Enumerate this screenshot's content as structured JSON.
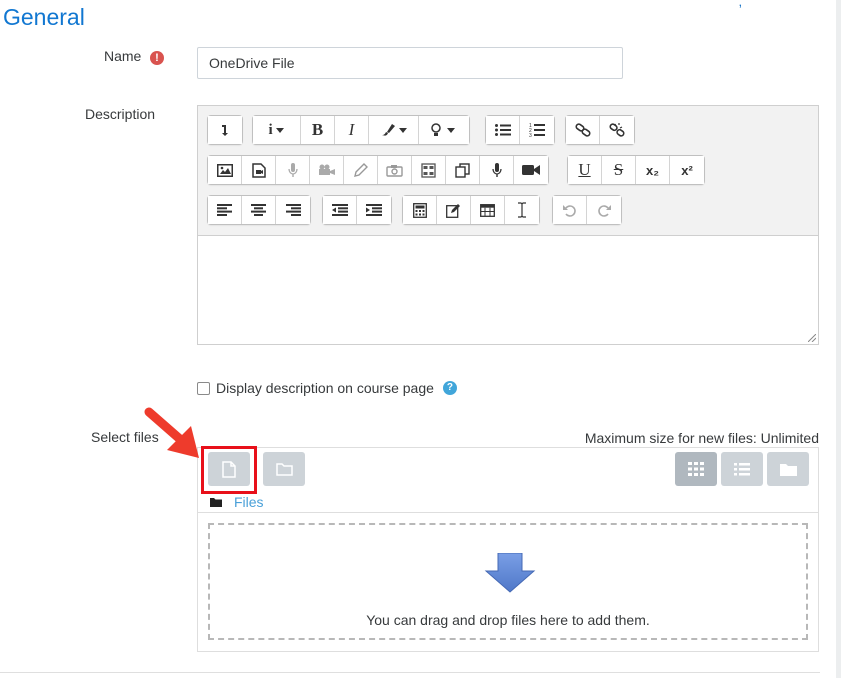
{
  "corner_fragment": "', ",
  "section": {
    "title": "General"
  },
  "name_field": {
    "label": "Name",
    "value": "OneDrive File",
    "required_icon": "exclamation-icon"
  },
  "description": {
    "label": "Description"
  },
  "editor": {
    "row1": [
      "collapse-icon",
      "info-icon",
      "bold-icon",
      "italic-icon",
      "brush-icon",
      "lightbulb-icon",
      "unordered-list-icon",
      "ordered-list-icon",
      "link-icon",
      "unlink-icon"
    ],
    "row2": [
      "image-icon",
      "media-icon",
      "microphone-icon",
      "video-camera-icon",
      "pencil-icon",
      "camera-icon",
      "table-layout-icon",
      "copy-icon",
      "record-audio-icon",
      "record-video-icon",
      "underline-icon",
      "strikethrough-icon",
      "subscript-icon",
      "superscript-icon"
    ],
    "row3": [
      "align-left-icon",
      "align-center-icon",
      "align-right-icon",
      "outdent-icon",
      "indent-icon",
      "calculator-icon",
      "edit-icon",
      "table-icon",
      "text-cursor-icon",
      "undo-icon",
      "redo-icon"
    ],
    "labels": {
      "bold": "B",
      "italic": "I",
      "underline": "U",
      "strike": "S",
      "subscript": "x₂",
      "superscript": "x²",
      "info": "i"
    }
  },
  "display_description": {
    "label": "Display description on course page",
    "checked": false,
    "help_icon": "?"
  },
  "select_files": {
    "label": "Select files",
    "max_size": "Maximum size for new files: Unlimited",
    "path_label": "Files",
    "drop_text": "You can drag and drop files here to add them.",
    "highlight_color": "#e8101a"
  },
  "colors": {
    "accent": "#1177d1",
    "link": "#4aa0d8",
    "arrow": "#5b82cf"
  }
}
